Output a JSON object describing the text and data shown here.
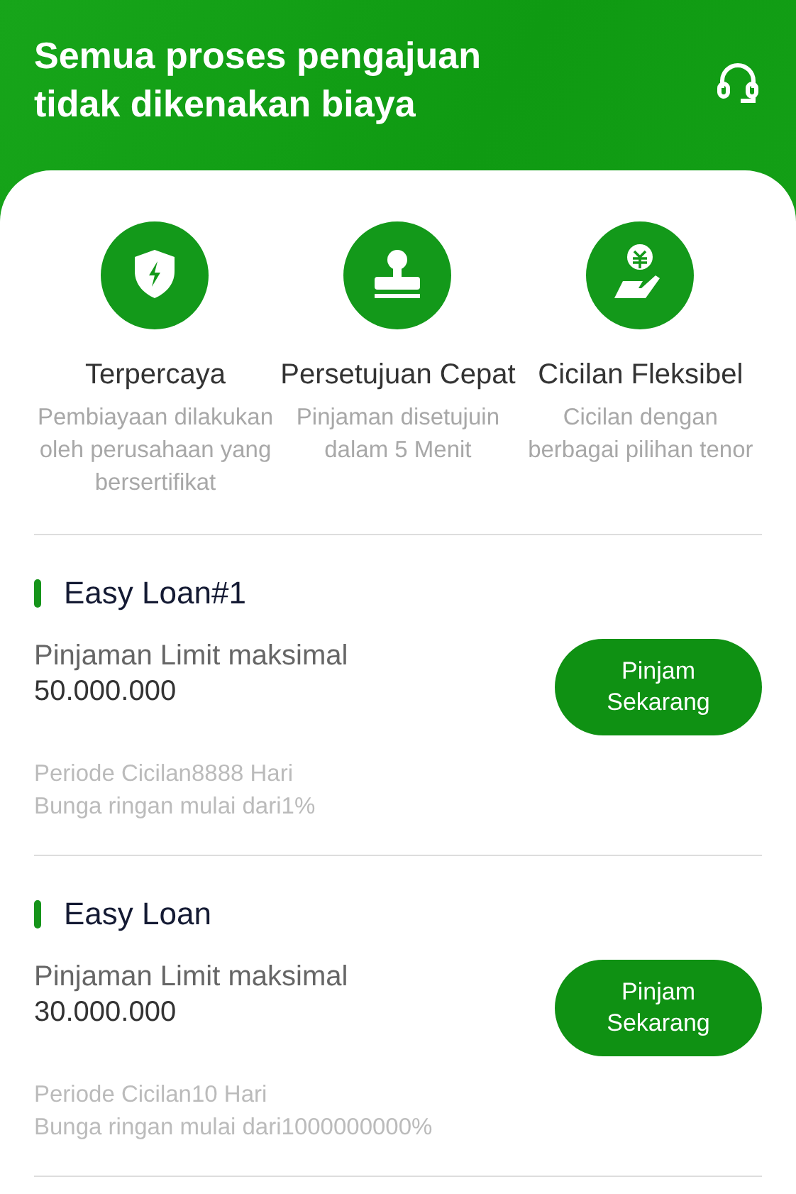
{
  "header": {
    "title": "Semua proses pengajuan tidak dikenakan biaya"
  },
  "features": [
    {
      "kind": "shield",
      "title": "Terpercaya",
      "description": "Pembiayaan dilakukan oleh perusahaan yang bersertifikat"
    },
    {
      "kind": "stamp",
      "title": "Persetujuan Cepat",
      "description": "Pinjaman disetujuin dalam 5 Menit"
    },
    {
      "kind": "hand-coin",
      "title": "Cicilan Fleksibel",
      "description": "Cicilan dengan berbagai pilihan tenor"
    }
  ],
  "loans": [
    {
      "name": "Easy Loan#1",
      "limit_label": "Pinjaman Limit maksimal",
      "amount": "50.000.000",
      "period": "Periode Cicilan8888 Hari",
      "interest": "Bunga ringan mulai dari1%",
      "button": "Pinjam Sekarang"
    },
    {
      "name": "Easy Loan",
      "limit_label": "Pinjaman Limit maksimal",
      "amount": "30.000.000",
      "period": "Periode Cicilan10 Hari",
      "interest": "Bunga ringan mulai dari1000000000%",
      "button": "Pinjam Sekarang"
    }
  ]
}
